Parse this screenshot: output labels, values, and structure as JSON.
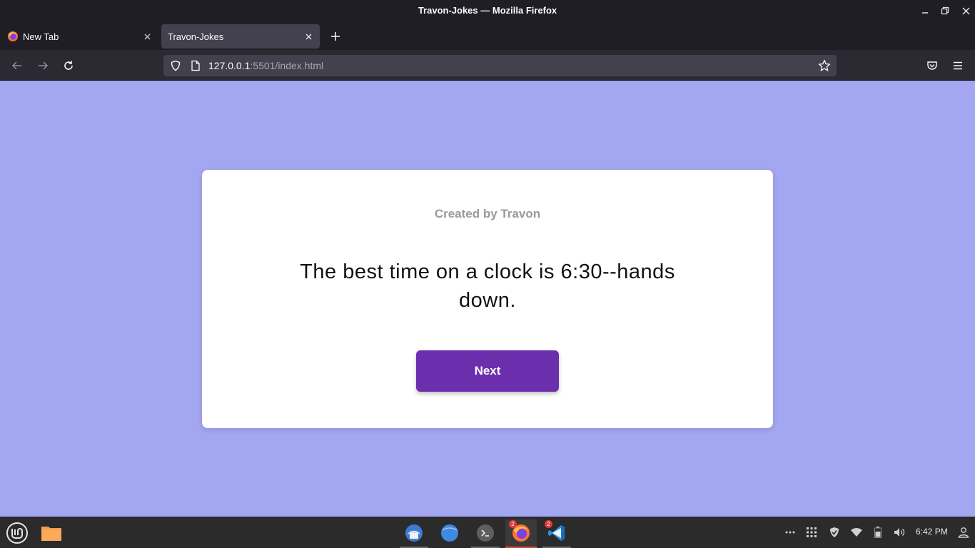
{
  "window": {
    "title": "Travon-Jokes — Mozilla Firefox"
  },
  "tabs": [
    {
      "label": "New Tab",
      "active": false
    },
    {
      "label": "Travon-Jokes",
      "active": true
    }
  ],
  "navbar": {
    "url_host": "127.0.0.1",
    "url_rest": ":5501/index.html"
  },
  "page": {
    "credit": "Created by Travon",
    "joke": "The best time on a clock is 6:30--hands down.",
    "next_button": "Next",
    "background_color": "#a3a6f0",
    "button_color": "#6b2ead"
  },
  "taskbar": {
    "firefox_badge": "2",
    "vscode_badge": "2",
    "clock": "6:42 PM"
  }
}
